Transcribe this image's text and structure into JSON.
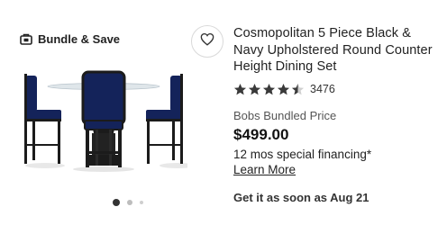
{
  "badge": {
    "label": "Bundle & Save",
    "icon": "bundle-icon"
  },
  "favorite": {
    "icon": "heart-icon"
  },
  "product": {
    "image_alt": "black pub-height dining set with navy chairs",
    "title": "Cosmopolitan 5 Piece Black & Navy Upholstered Round Counter Height Dining Set",
    "rating": {
      "stars": 4.5,
      "max": 5,
      "count": "3476"
    },
    "price_label": "Bobs Bundled Price",
    "price": "$499.00",
    "financing": "12 mos special financing*",
    "learn_more": "Learn More",
    "shipping": "Get it as soon as Aug 21"
  },
  "carousel": {
    "total": 3,
    "active": 1
  },
  "colors": {
    "navy": "#14235a",
    "black": "#1b1b1b",
    "text": "#222222"
  }
}
